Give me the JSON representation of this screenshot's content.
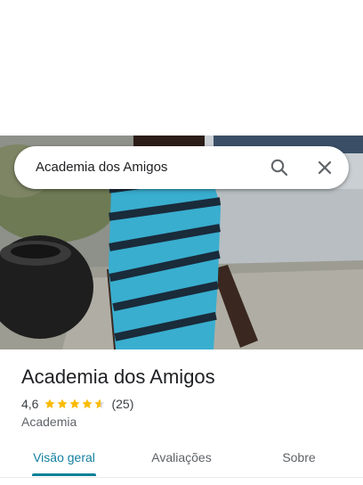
{
  "search": {
    "query": "Academia dos Amigos"
  },
  "place": {
    "name": "Academia dos Amigos",
    "rating": "4,6",
    "rating_stars": 4.6,
    "review_count": "(25)",
    "category": "Academia"
  },
  "tabs": [
    {
      "label": "Visão geral",
      "active": true
    },
    {
      "label": "Avaliações",
      "active": false
    },
    {
      "label": "Sobre",
      "active": false
    }
  ],
  "icons": {
    "search": "search-icon",
    "close": "close-icon",
    "star": "star-icon"
  },
  "colors": {
    "accent": "#0b8098",
    "star": "#fbbc04",
    "star_empty": "#dadce0"
  }
}
